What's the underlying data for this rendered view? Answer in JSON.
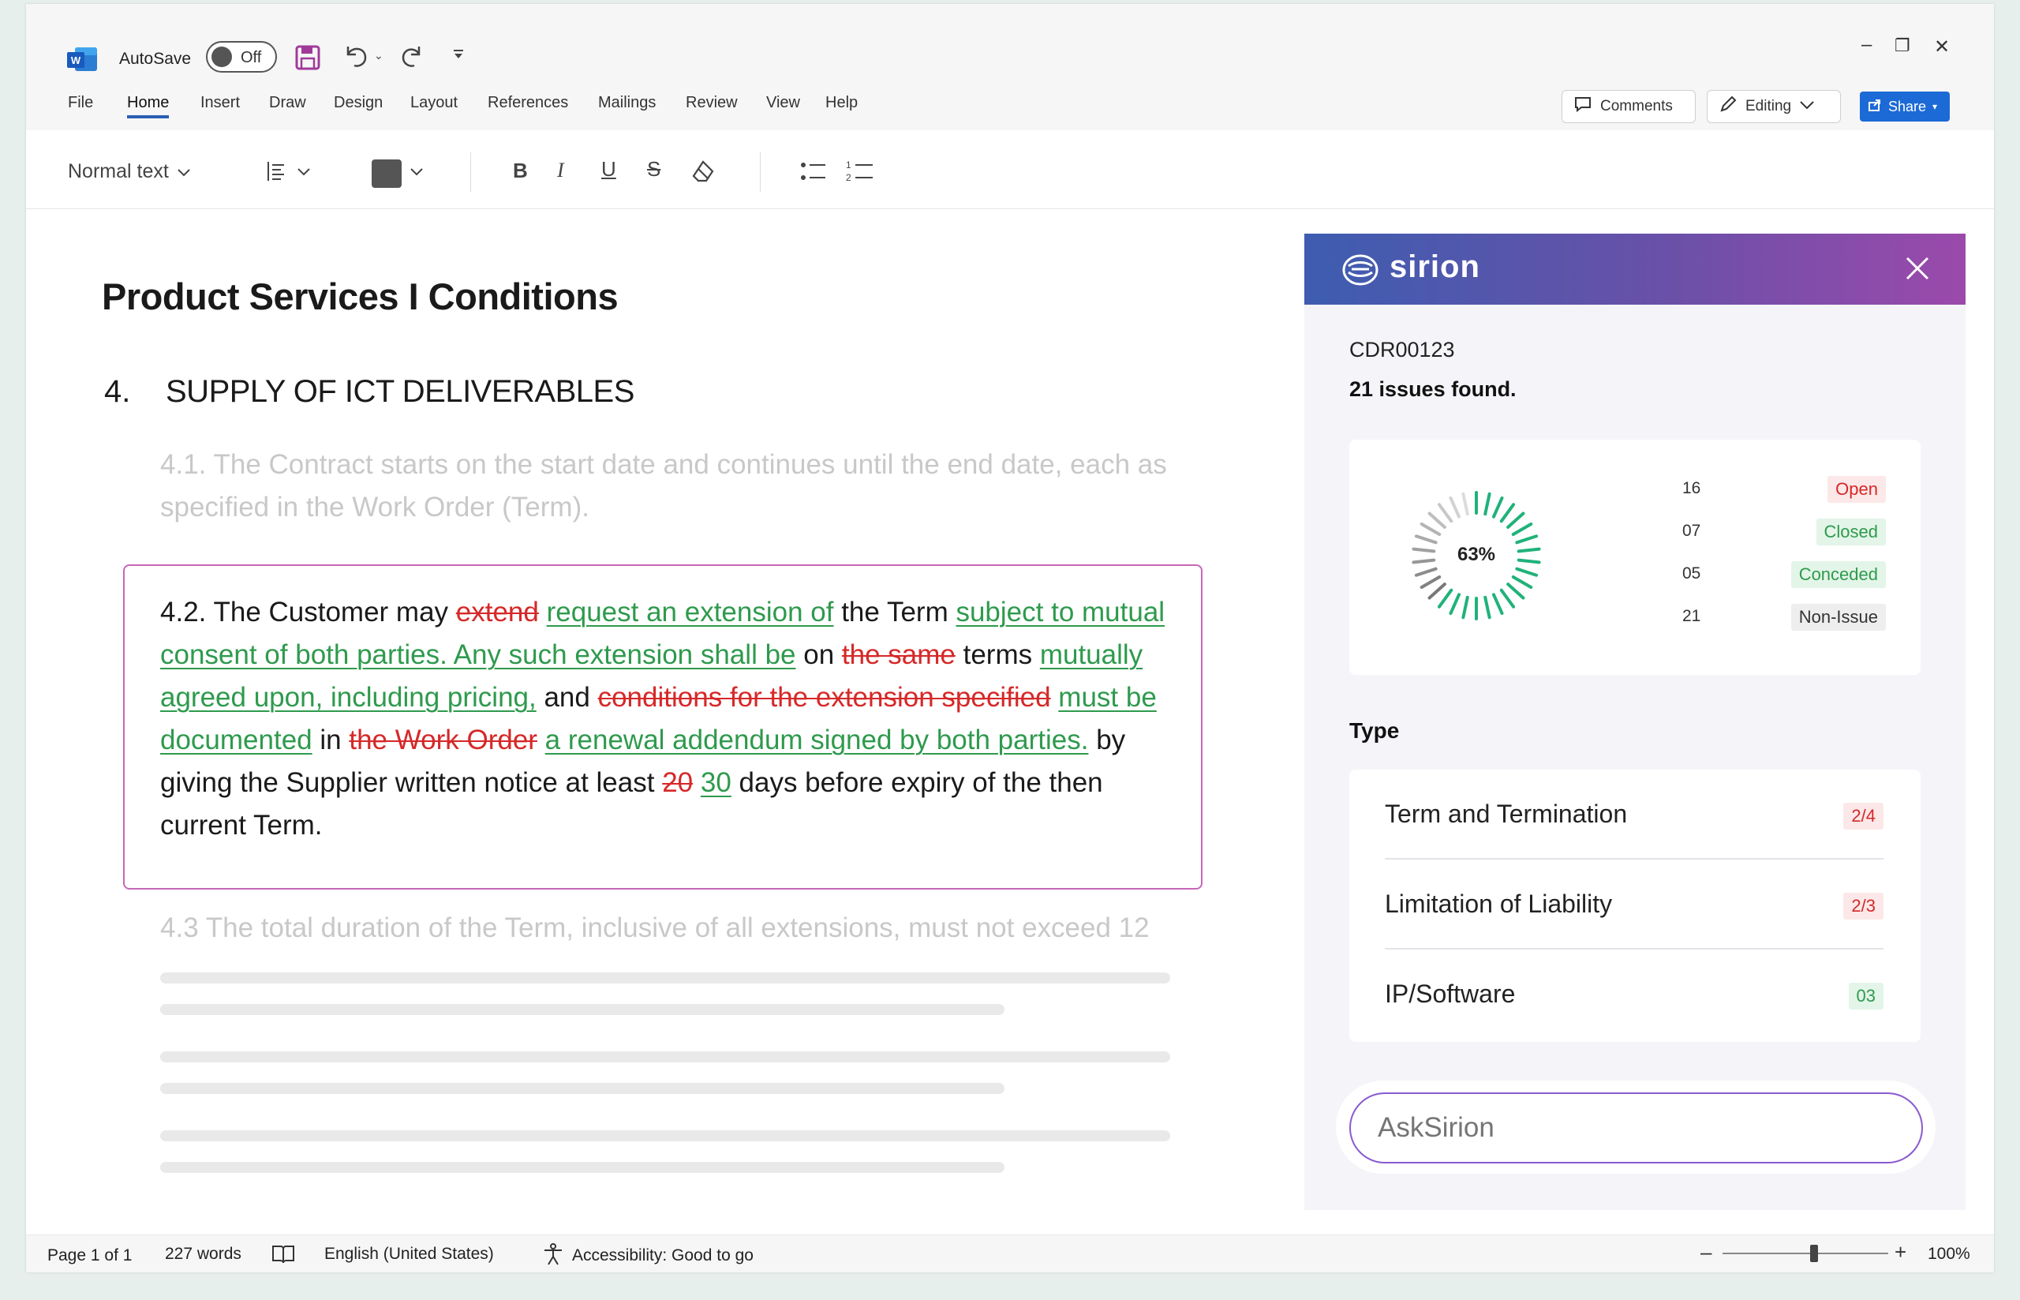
{
  "titlebar": {
    "autosave_label": "AutoSave",
    "autosave_state": "Off",
    "controls": {
      "minimize": "–",
      "restore": "❐",
      "close": "✕"
    }
  },
  "menu": {
    "items": [
      "File",
      "Home",
      "Insert",
      "Draw",
      "Design",
      "Layout",
      "References",
      "Mailings",
      "Review",
      "View",
      "Help"
    ],
    "active": "Home"
  },
  "actions": {
    "comments": "Comments",
    "editing": "Editing",
    "share": "Share"
  },
  "ribbon": {
    "style_select": "Normal text"
  },
  "document": {
    "title": "Product Services I Conditions",
    "section_number": "4.",
    "section_title": "SUPPLY OF ICT DELIVERABLES",
    "para_4_1": "4.1. The Contract starts on the start date and continues until the end date, each as specified in the Work Order (Term).",
    "para_4_2": {
      "t1": "4.2. The Customer may ",
      "d1": "extend",
      "i1": "request an extension of",
      "t2": " the Term ",
      "i2": "subject to mutual consent of both parties. Any such extension shall be",
      "t3": " on ",
      "d2": "the same",
      "t4": " terms ",
      "i3": "mutually agreed upon, including pricing,",
      "t5": " and ",
      "d3": "conditions for the extension specified",
      "i4": "must be documented",
      "t6": " in ",
      "d4": "the Work Order",
      "i5": "a renewal addendum signed by both parties.",
      "t7": " by giving the Supplier written notice at least ",
      "d5": "20",
      "i6": "30",
      "t8": " days before expiry of the then current Term."
    },
    "para_4_3": "4.3 The total duration of the Term, inclusive of all extensions, must not exceed 12"
  },
  "panel": {
    "brand": "sirion",
    "doc_id": "CDR00123",
    "issues_found": "21 issues found.",
    "progress_percent": 63,
    "progress_label": "63%",
    "stats": [
      {
        "count": "16",
        "label": "Open"
      },
      {
        "count": "07",
        "label": "Closed"
      },
      {
        "count": "05",
        "label": "Conceded"
      },
      {
        "count": "21",
        "label": "Non-Issue"
      }
    ],
    "type_heading": "Type",
    "types": [
      {
        "label": "Term and Termination",
        "badge": "2/4"
      },
      {
        "label": "Limitation of Liability",
        "badge": "2/3"
      },
      {
        "label": "IP/Software",
        "badge": "03"
      }
    ],
    "ask_placeholder": "AskSirion"
  },
  "status": {
    "page": "Page 1 of 1",
    "words": "227 words",
    "language": "English (United States)",
    "accessibility": "Accessibility: Good to go",
    "zoom": "100%",
    "zoom_level": 0.55
  },
  "colors": {
    "accent_blue": "#1c6ad6",
    "insert_green": "#2e9a4d",
    "delete_red": "#d62828",
    "panel_gradient_start": "#3d5db0",
    "panel_gradient_end": "#9b4aab",
    "ask_border": "#8a5ad0"
  }
}
